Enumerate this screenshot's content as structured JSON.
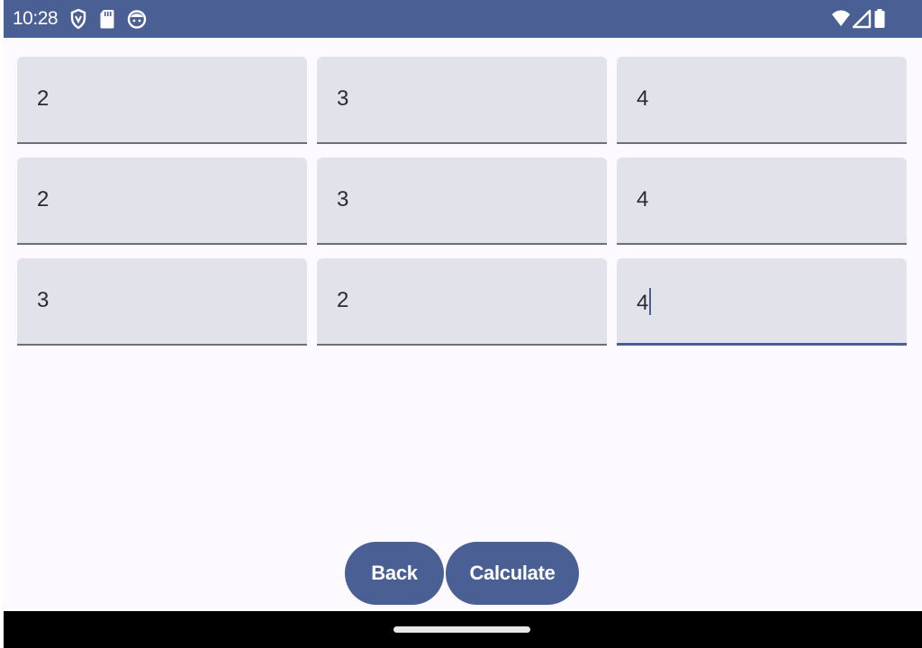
{
  "status_bar": {
    "time": "10:28",
    "left_icons": [
      "shield-icon",
      "sd-card-icon",
      "face-icon"
    ],
    "right_icons": [
      "wifi-icon",
      "cell-signal-icon",
      "battery-icon"
    ],
    "background_color": "#4a5f93"
  },
  "matrix": {
    "rows": [
      [
        "2",
        "3",
        "4"
      ],
      [
        "2",
        "3",
        "4"
      ],
      [
        "3",
        "2",
        "4"
      ]
    ],
    "focused_cell": [
      2,
      2
    ]
  },
  "buttons": {
    "back_label": "Back",
    "calculate_label": "Calculate",
    "color": "#4a5f93"
  },
  "nav_bar": {
    "handle": "home-handle"
  }
}
